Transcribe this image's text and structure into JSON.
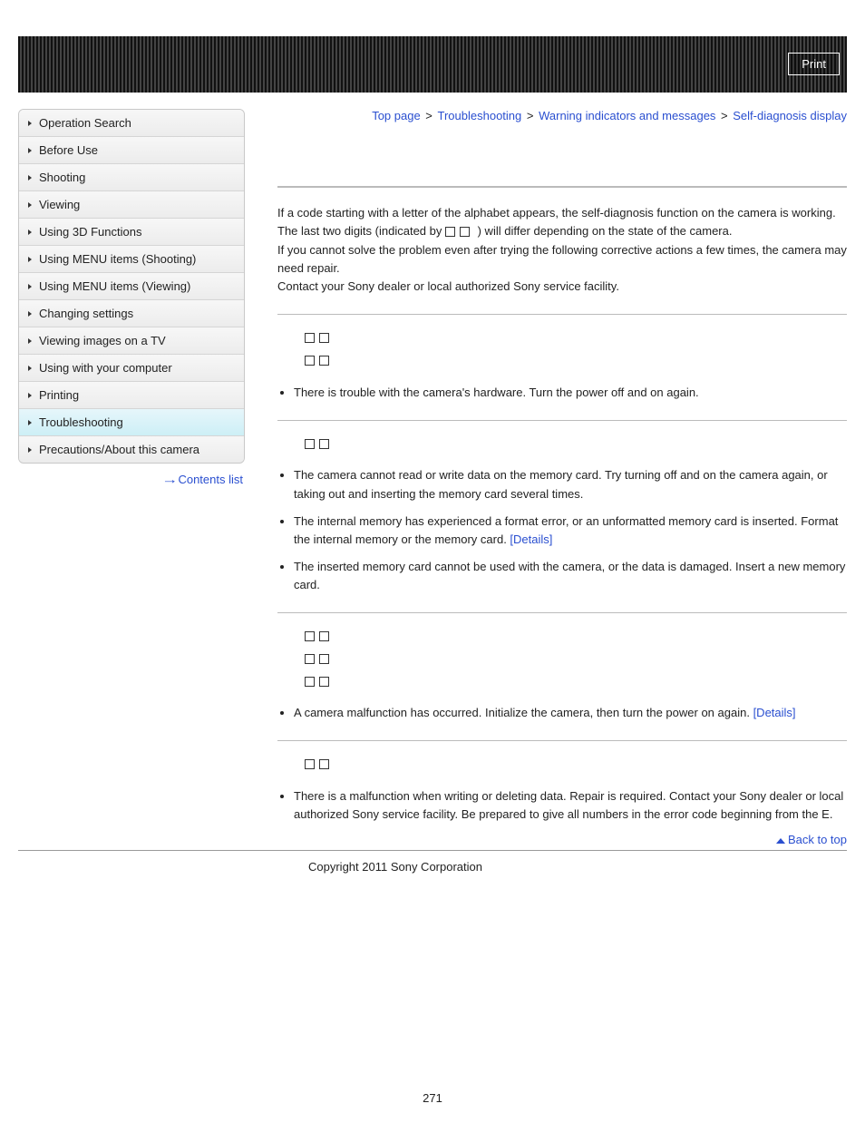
{
  "header": {
    "print_label": "Print"
  },
  "sidebar": {
    "items": [
      {
        "label": "Operation Search",
        "active": false
      },
      {
        "label": "Before Use",
        "active": false
      },
      {
        "label": "Shooting",
        "active": false
      },
      {
        "label": "Viewing",
        "active": false
      },
      {
        "label": "Using 3D Functions",
        "active": false
      },
      {
        "label": "Using MENU items (Shooting)",
        "active": false
      },
      {
        "label": "Using MENU items (Viewing)",
        "active": false
      },
      {
        "label": "Changing settings",
        "active": false
      },
      {
        "label": "Viewing images on a TV",
        "active": false
      },
      {
        "label": "Using with your computer",
        "active": false
      },
      {
        "label": "Printing",
        "active": false
      },
      {
        "label": "Troubleshooting",
        "active": true
      },
      {
        "label": "Precautions/About this camera",
        "active": false
      }
    ],
    "contents_list_label": "Contents list"
  },
  "breadcrumb": {
    "items": [
      "Top page",
      "Troubleshooting",
      "Warning indicators and messages",
      "Self-diagnosis display"
    ],
    "separator": ">"
  },
  "intro": {
    "text_before_squares": "If a code starting with a letter of the alphabet appears, the self-diagnosis function on the camera is working. The last two digits (indicated by ",
    "text_after_squares": ") will differ depending on the state of the camera.",
    "line2": "If you cannot solve the problem even after trying the following corrective actions a few times, the camera may need repair.",
    "line3": "Contact your Sony dealer or local authorized Sony service facility."
  },
  "sections": [
    {
      "code_lines": 2,
      "bullets": [
        {
          "text": "There is trouble with the camera's hardware. Turn the power off and on again."
        }
      ]
    },
    {
      "code_lines": 1,
      "bullets": [
        {
          "text": "The camera cannot read or write data on the memory card. Try turning off and on the camera again, or taking out and inserting the memory card several times."
        },
        {
          "text": "The internal memory has experienced a format error, or an unformatted memory card is inserted. Format the internal memory or the memory card. ",
          "link": "[Details]"
        },
        {
          "text": "The inserted memory card cannot be used with the camera, or the data is damaged. Insert a new memory card."
        }
      ]
    },
    {
      "code_lines": 3,
      "bullets": [
        {
          "text": "A camera malfunction has occurred. Initialize the camera, then turn the power on again. ",
          "link": "[Details]"
        }
      ]
    },
    {
      "code_lines": 1,
      "bullets": [
        {
          "text": "There is a malfunction when writing or deleting data. Repair is required. Contact your Sony dealer or local authorized Sony service facility. Be prepared to give all numbers in the error code beginning from the E."
        }
      ]
    }
  ],
  "back_to_top_label": "Back to top",
  "footer": {
    "copyright": "Copyright 2011 Sony Corporation",
    "page_number": "271"
  }
}
